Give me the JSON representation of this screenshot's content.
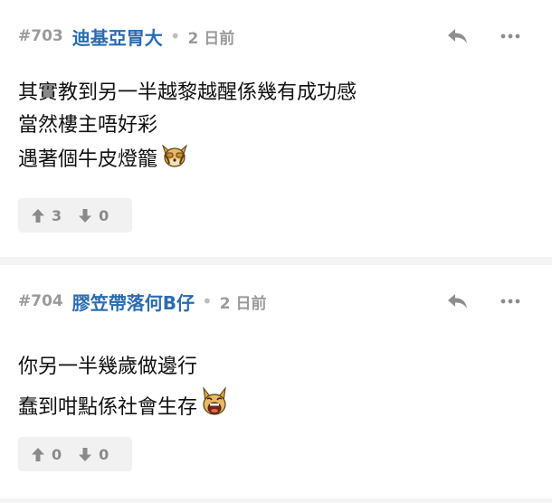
{
  "posts": [
    {
      "number": "#703",
      "username": "迪基亞胃大",
      "separator": "•",
      "time": "2 日前",
      "lines": [
        "其實教到另一半越黎越醒係幾有成功感",
        "當然樓主唔好彩",
        "遇著個牛皮燈籠"
      ],
      "emoji_icon": "dog-covering-face-emoji",
      "upvotes": "3",
      "downvotes": "0"
    },
    {
      "number": "#704",
      "username": "膠笠帶落何B仔",
      "separator": "•",
      "time": "2 日前",
      "lines": [
        "你另一半幾歲做邊行",
        "蠢到咁點係社會生存"
      ],
      "emoji_icon": "dog-laughing-emoji",
      "upvotes": "0",
      "downvotes": "0"
    }
  ],
  "icons": {
    "reply": "reply-icon",
    "more": "more-icon",
    "upvote": "upvote-icon",
    "downvote": "downvote-icon"
  },
  "colors": {
    "username": "#2b6cb0",
    "muted": "#9a9a9a",
    "vote_bg": "#f1f1f1",
    "page_bg": "#f4f4f4"
  }
}
